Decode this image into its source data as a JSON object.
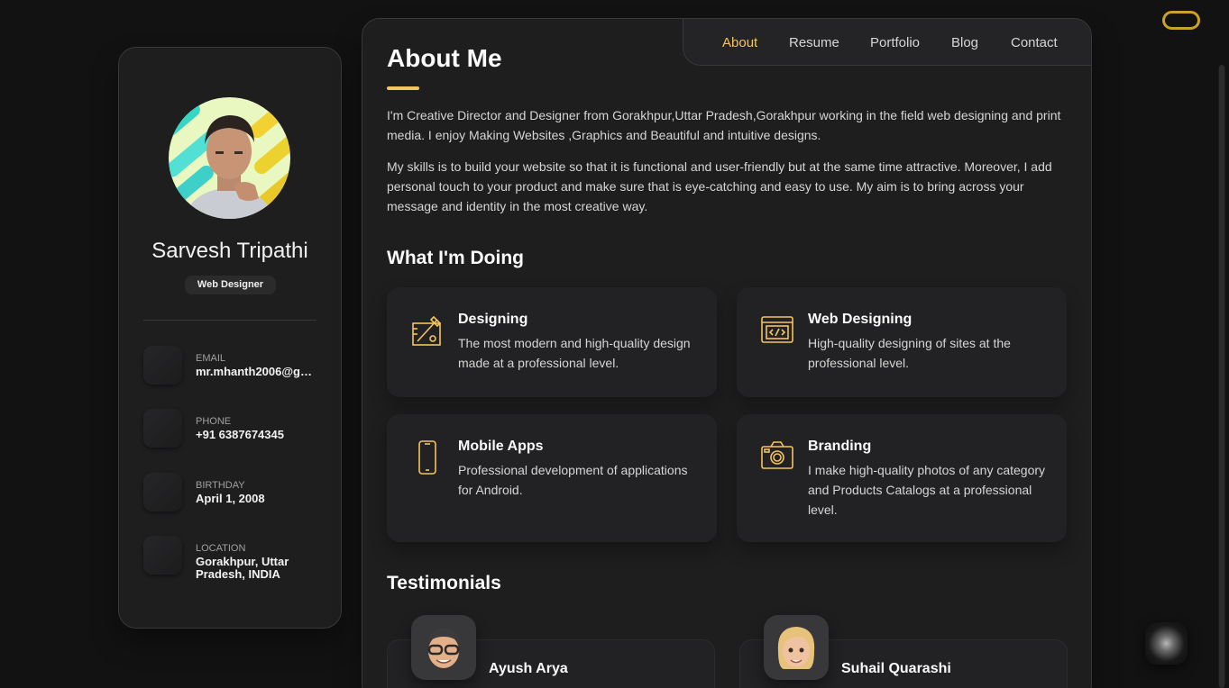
{
  "sidebar": {
    "name": "Sarvesh Tripathi",
    "title": "Web Designer",
    "contacts": [
      {
        "label": "EMAIL",
        "value": "mr.mhanth2006@gm..."
      },
      {
        "label": "PHONE",
        "value": "+91 6387674345"
      },
      {
        "label": "BIRTHDAY",
        "value": "April 1, 2008"
      },
      {
        "label": "LOCATION",
        "value": "Gorakhpur, Uttar Pradesh, INDIA"
      }
    ]
  },
  "nav": {
    "items": [
      "About",
      "Resume",
      "Portfolio",
      "Blog",
      "Contact"
    ],
    "active": "About"
  },
  "about": {
    "title": "About Me",
    "paragraphs": [
      "I'm Creative Director and Designer from Gorakhpur,Uttar Pradesh,Gorakhpur working in the field web designing and print media. I enjoy Making Websites ,Graphics and Beautiful and intuitive designs.",
      "My skills is to build your website so that it is functional and user-friendly but at the same time attractive. Moreover, I add personal touch to your product and make sure that is eye-catching and easy to use. My aim is to bring across your message and identity in the most creative way."
    ]
  },
  "services": {
    "heading": "What I'm Doing",
    "items": [
      {
        "icon": "design-icon",
        "title": "Designing",
        "text": "The most modern and high-quality design made at a professional level."
      },
      {
        "icon": "code-window-icon",
        "title": "Web Designing",
        "text": "High-quality designing of sites at the professional level."
      },
      {
        "icon": "smartphone-icon",
        "title": "Mobile Apps",
        "text": "Professional development of applications for Android."
      },
      {
        "icon": "camera-icon",
        "title": "Branding",
        "text": "I make high-quality photos of any category and Products Catalogs at a professional level."
      }
    ]
  },
  "testimonials": {
    "heading": "Testimonials",
    "items": [
      {
        "name": "Ayush Arya"
      },
      {
        "name": "Suhail Quarashi"
      }
    ]
  },
  "colors": {
    "accent": "#f5c45e",
    "background": "#121212",
    "card": "#1e1e1f"
  }
}
